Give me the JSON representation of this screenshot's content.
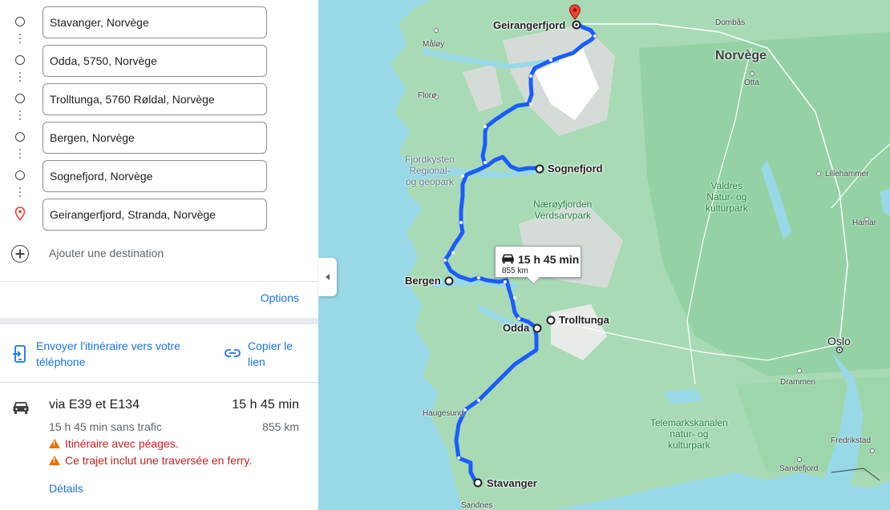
{
  "stops": [
    {
      "value": "Stavanger, Norvège"
    },
    {
      "value": "Odda, 5750, Norvège"
    },
    {
      "value": "Trolltunga, 5760 Røldal, Norvège"
    },
    {
      "value": "Bergen, Norvège"
    },
    {
      "value": "Sognefjord, Norvège"
    },
    {
      "value": "Geirangerfjord, Stranda, Norvège"
    }
  ],
  "add_destination": "Ajouter une destination",
  "options": "Options",
  "actions": {
    "send_line1": "Envoyer l'itinéraire vers votre",
    "send_line2": "téléphone",
    "copy_line1": "Copier le",
    "copy_line2": "lien"
  },
  "route": {
    "via": "via E39 et E134",
    "duration": "15 h 45 min",
    "traffic": "15 h 45 min sans trafic",
    "distance": "855 km",
    "warning_tolls": "Itinéraire avec péages.",
    "warning_ferry": "Ce trajet inclut une traversée en ferry.",
    "details": "Détails"
  },
  "map": {
    "callout_time": "15 h 45 min",
    "callout_dist": "855 km",
    "places": {
      "geirangerfjord": "Geirangerfjord",
      "sognefjord": "Sognefjord",
      "bergen": "Bergen",
      "odda": "Odda",
      "trolltunga": "Trolltunga",
      "stavanger": "Stavanger",
      "oslo": "Oslo"
    },
    "country": "Norvège",
    "small": {
      "dombas": "Dombås",
      "maloy": "Måløy",
      "otta": "Otta",
      "floro": "Florø",
      "lillehammer": "Lillehammer",
      "hamar": "Hamar",
      "drammen": "Drammen",
      "haugesund": "Haugesund",
      "fredrikstad": "Fredrikstad",
      "sandefjord": "Sandefjord",
      "sandnes": "Sandnes"
    },
    "parks": {
      "fjordkysten_1": "Fjordkysten",
      "fjordkysten_2": "Regional-",
      "fjordkysten_3": "og geopark",
      "naeroy_1": "Nærøyfjorden",
      "naeroy_2": "Verdsarvpark",
      "valdres_1": "Valdres",
      "valdres_2": "Natur- og",
      "valdres_3": "kulturpark",
      "telemark_1": "Telemarkskanalen",
      "telemark_2": "natur- og",
      "telemark_3": "kulturpark"
    }
  },
  "colors": {
    "route": "#1a5cff",
    "link": "#1a73e8",
    "warning": "#c5221f",
    "water": "#99d8e6",
    "land": "#a8dab5"
  }
}
